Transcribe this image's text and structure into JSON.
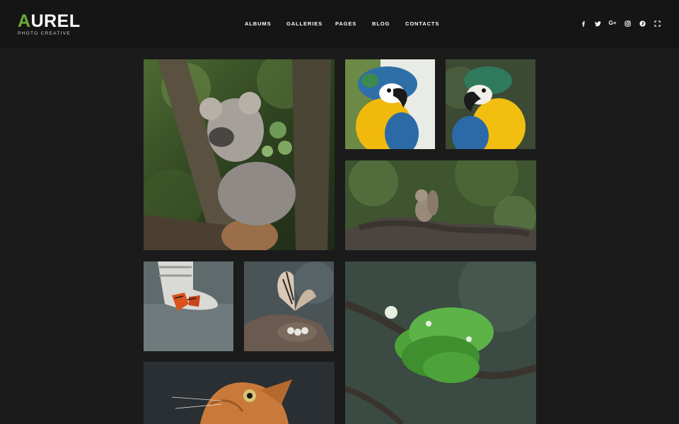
{
  "brand": {
    "logo_first_letter": "A",
    "logo_rest": "UREL",
    "tagline": "PHOTO CREATIVE",
    "accent_color": "#6aaa3a"
  },
  "nav": {
    "items": [
      "ALBUMS",
      "GALLERIES",
      "PAGES",
      "BLOG",
      "CONTACTS"
    ]
  },
  "social": {
    "icons": [
      "facebook-icon",
      "twitter-icon",
      "google-plus-icon",
      "instagram-icon",
      "pinterest-icon",
      "fullscreen-icon"
    ],
    "google_plus_glyph": "G+"
  },
  "gallery": {
    "photos": [
      "koala",
      "parrot",
      "parrot",
      "squirrel",
      "butterfly-on-shoe",
      "butterfly-on-nest",
      "green-snake",
      "cat"
    ]
  },
  "colors": {
    "background": "#1b1b1b",
    "header": "#151515",
    "text": "#ffffff"
  }
}
